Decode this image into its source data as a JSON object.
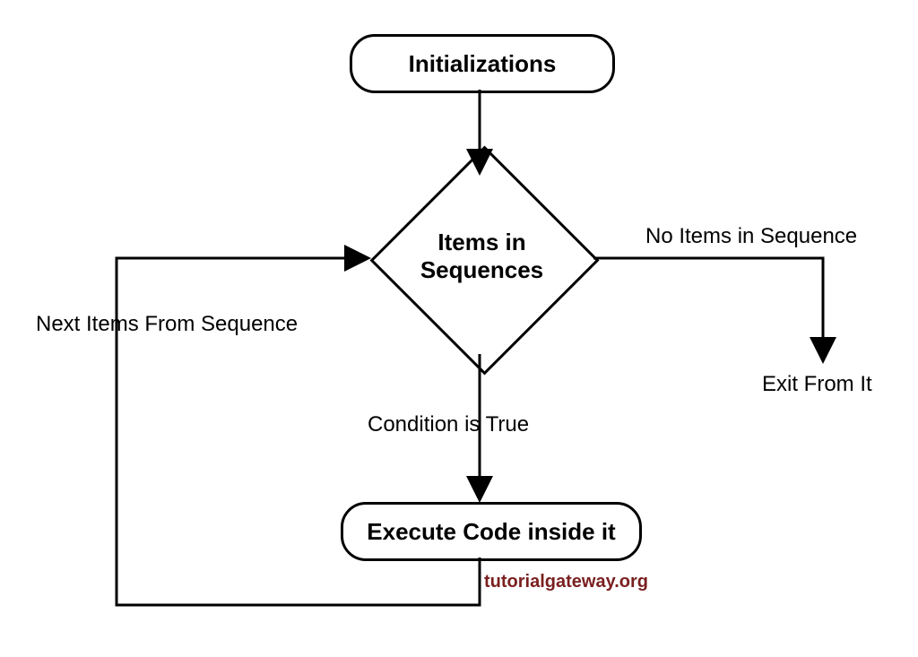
{
  "flowchart": {
    "nodes": {
      "start": {
        "label": "Initializations"
      },
      "decision": {
        "line1": "Items in",
        "line2": "Sequences"
      },
      "process": {
        "label": "Execute Code inside it"
      }
    },
    "edges": {
      "right": "No Items in Sequence",
      "exit": "Exit From It",
      "down": "Condition is True",
      "loop": "Next Items From Sequence"
    },
    "watermark": "tutorialgateway.org"
  }
}
